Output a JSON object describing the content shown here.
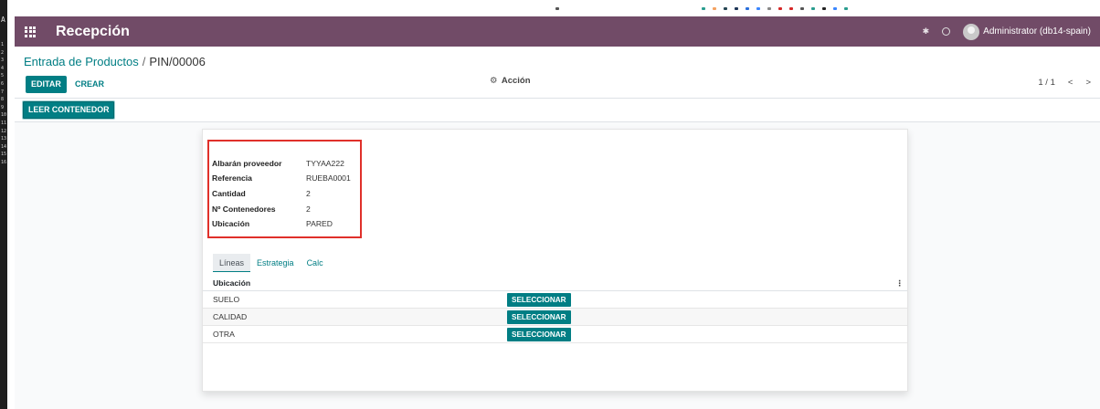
{
  "app": {
    "title": "Recepción",
    "user": "Administrator (db14-spain)"
  },
  "breadcrumb": {
    "parent": "Entrada de Productos",
    "separator": "/",
    "current": "PIN/00006"
  },
  "toolbar": {
    "edit_label": "EDITAR",
    "create_label": "CREAR",
    "action_label": "Acción",
    "pager": "1 / 1",
    "prev": "<",
    "next": ">"
  },
  "statusbar": {
    "read_container_label": "LEER CONTENEDOR"
  },
  "left_strip": {
    "letter": "A",
    "line_numbers": [
      "1",
      "2",
      "3",
      "4",
      "5",
      "6",
      "7",
      "8",
      "9",
      "10",
      "11",
      "12",
      "13",
      "14",
      "15",
      "16"
    ]
  },
  "form": {
    "fields": [
      {
        "label": "Albarán proveedor",
        "value": "TYYAA222"
      },
      {
        "label": "Referencia",
        "value": "RUEBA0001"
      },
      {
        "label": "Cantidad",
        "value": "2"
      },
      {
        "label": "Nº Contenedores",
        "value": "2"
      },
      {
        "label": "Ubicación",
        "value": "PARED"
      }
    ],
    "tabs": [
      "Líneas",
      "Estrategia",
      "Calc"
    ],
    "table": {
      "header": "Ubicación",
      "column_menu": "⋮",
      "button_label": "SELECCIONAR",
      "rows": [
        "SUELO",
        "CALIDAD",
        "OTRA"
      ]
    }
  },
  "colors": {
    "navbar": "#714b67",
    "primary": "#017e84",
    "highlight": "#e0302a"
  }
}
